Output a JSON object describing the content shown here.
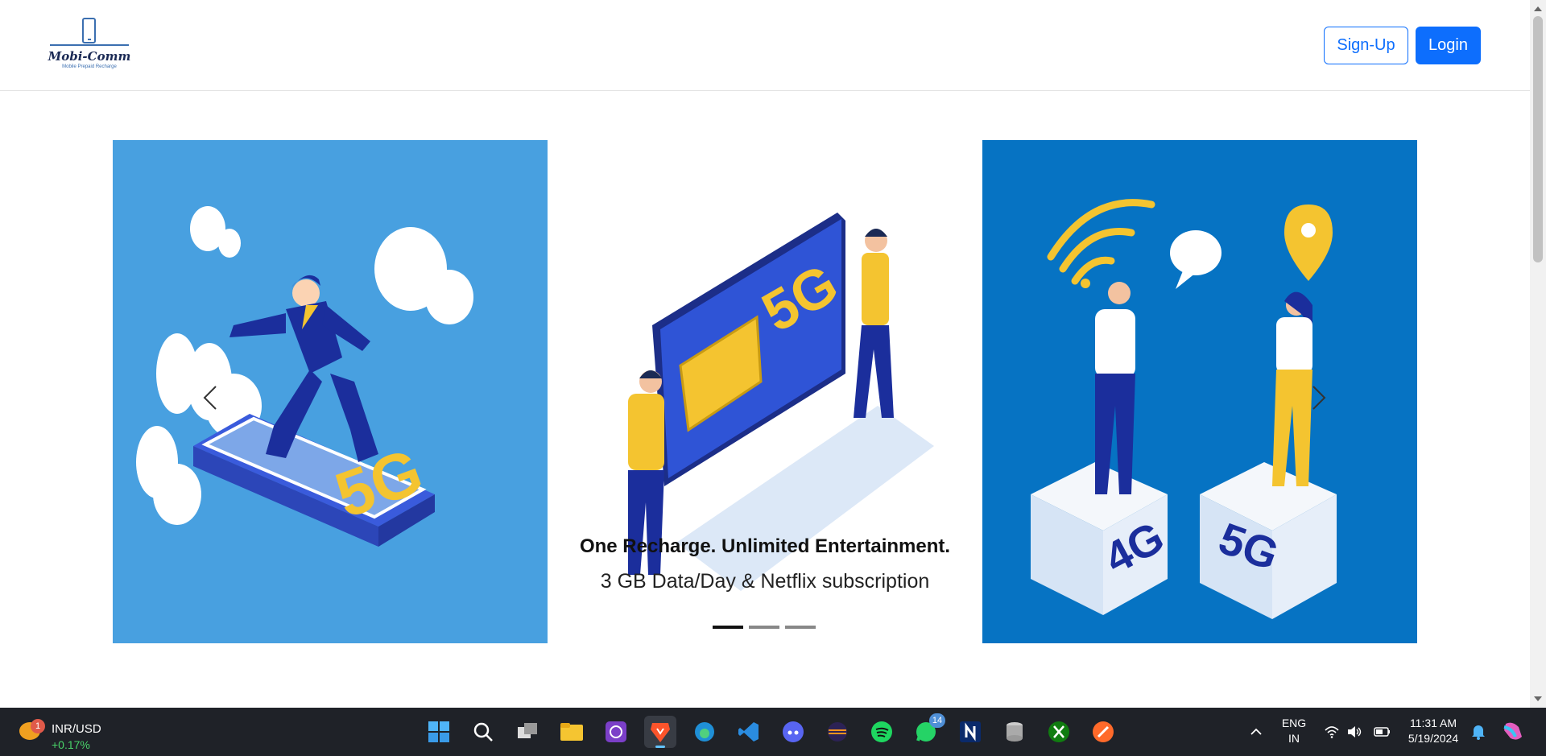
{
  "header": {
    "brand_name": "Mobi-Comm",
    "brand_tagline": "Mobile Prepaid Recharge",
    "signup_label": "Sign-Up",
    "login_label": "Login"
  },
  "carousel": {
    "caption_title": "One Recharge. Unlimited Entertainment.",
    "caption_text": "3 GB Data/Day & Netflix subscription",
    "slide_labels": [
      "5G",
      "5G",
      "4G",
      "5G"
    ],
    "indicators": 3,
    "active_indicator": 0
  },
  "taskbar": {
    "widget_badge": "1",
    "widget_pair": "INR/USD",
    "widget_change": "+0.17%",
    "whatsapp_badge": "14",
    "lang_line1": "ENG",
    "lang_line2": "IN",
    "time": "11:31 AM",
    "date": "5/19/2024",
    "icons": [
      "windows-start-icon",
      "search-icon",
      "task-view-icon",
      "file-explorer-icon",
      "photo-app-icon",
      "brave-browser-icon",
      "edge-browser-icon",
      "vscode-icon",
      "discord-icon",
      "eclipse-icon",
      "spotify-icon",
      "whatsapp-icon",
      "notion-icon",
      "database-icon",
      "xbox-icon",
      "sublime-icon"
    ]
  },
  "colors": {
    "primary": "#0d6efd",
    "slide1_bg": "#48a0e0",
    "slide3_bg": "#0673c3",
    "yellow": "#f4c430",
    "navy": "#1b2e9c"
  }
}
